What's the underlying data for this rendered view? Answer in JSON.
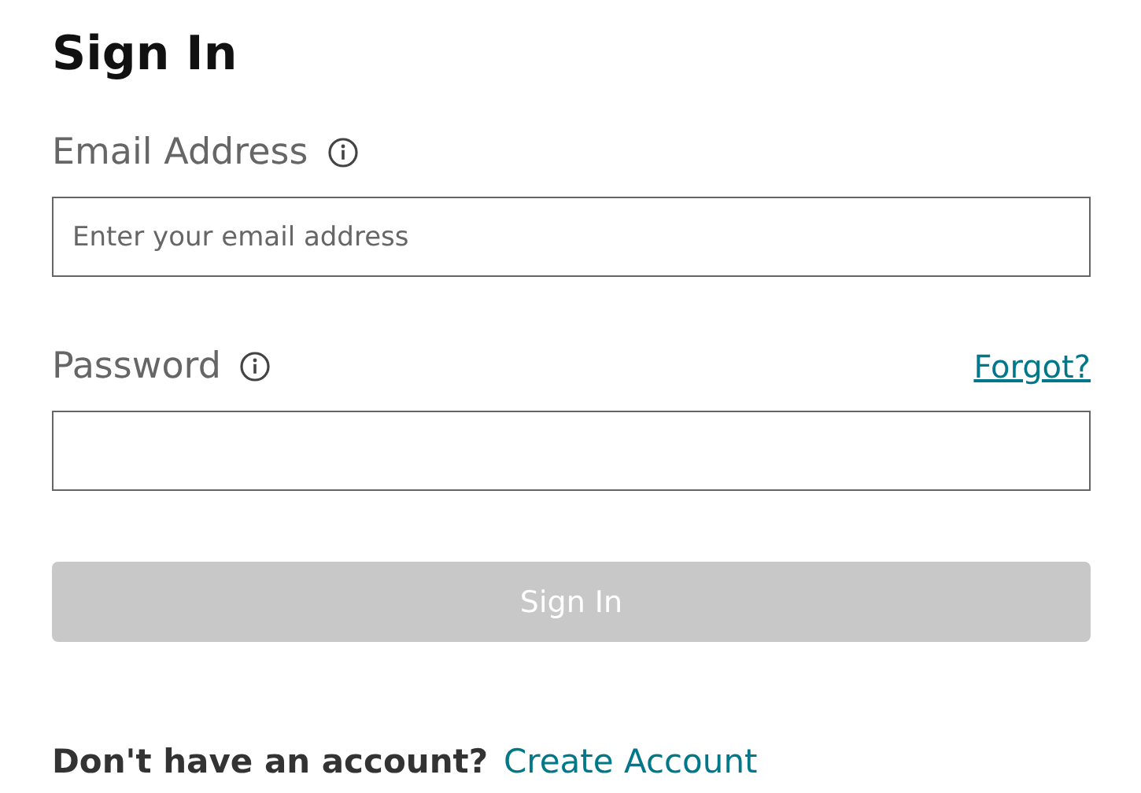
{
  "title": "Sign In",
  "fields": [
    {
      "label": "Email Address",
      "placeholder": "Enter your email address"
    },
    {
      "label": "Password",
      "link": "Forgot?"
    }
  ],
  "submit": {
    "label": "Sign In",
    "disabled": true
  },
  "footer": {
    "text": "Don't have an account?",
    "link": "Create Account"
  }
}
